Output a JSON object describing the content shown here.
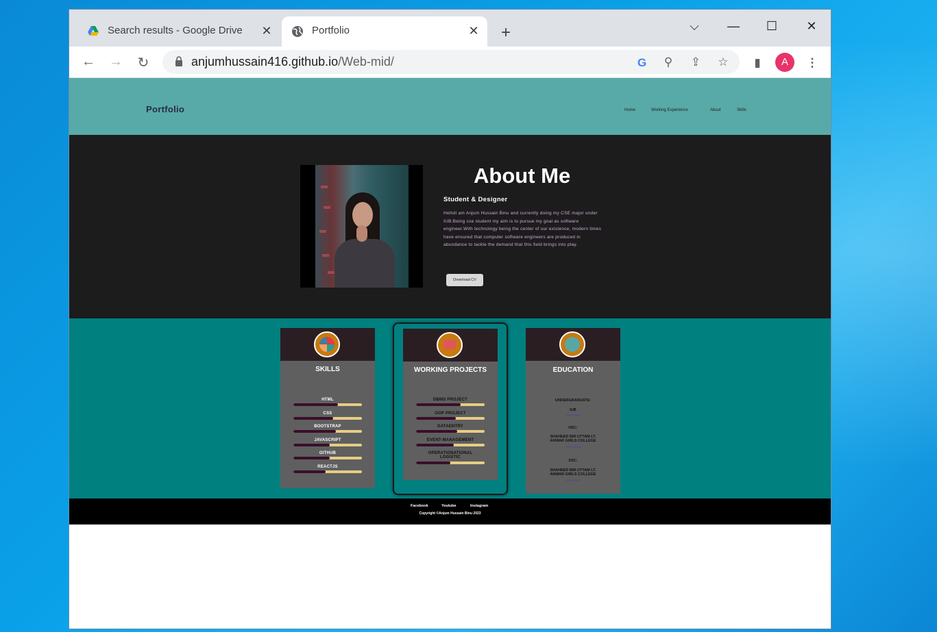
{
  "browser": {
    "tabs": [
      {
        "title": "Search results - Google Drive",
        "icon": "google-drive-icon",
        "active": false
      },
      {
        "title": "Portfolio",
        "icon": "globe-icon",
        "active": true
      }
    ],
    "new_tab_label": "+",
    "url_host": "anjumhussain416.github.io",
    "url_path": "/Web-mid/",
    "profile_initial": "A"
  },
  "site": {
    "logo": "Portfolio",
    "nav": [
      "Home",
      "Working Experience",
      "About",
      "Skills"
    ]
  },
  "about": {
    "title": "About Me",
    "subtitle": "Student & Designer",
    "text": "Helloll am Anjum Hussain Binu and currently doing my CSE major under IUB.Being cse student my aim is to pursue my goal as software engineer.With technology being the center of our existence, modern times have ensured that computer software engineers are produced in abundance to tackle the demand that this field brings into play.",
    "cv_button": "Download CV"
  },
  "skills": {
    "title": "SKILLS",
    "items": [
      {
        "label": "HTML",
        "level": 0.65
      },
      {
        "label": "CSS",
        "level": 0.58
      },
      {
        "label": "BOOTSTRAP",
        "level": 0.62
      },
      {
        "label": "JAVASCRIPT",
        "level": 0.53
      },
      {
        "label": "GITHUB",
        "level": 0.53
      },
      {
        "label": "REACTJS",
        "level": 0.47
      }
    ]
  },
  "projects": {
    "title": "WORKING PROJECTS",
    "items": [
      {
        "label": "DBMS PROJECT",
        "level": 0.65
      },
      {
        "label": "OOP PROJECT",
        "level": 0.58
      },
      {
        "label": "DATAENTRY",
        "level": 0.6
      },
      {
        "label": "EVENT-MANAGEMENT",
        "level": 0.55
      },
      {
        "label": "OPERATIONATIONAL LOGISTIC",
        "level": 0.5
      }
    ]
  },
  "education": {
    "title": "EDUCATION",
    "undergrad_label": "UNDERGRADUATE:",
    "undergrad_school": "IUB",
    "undergrad_years": "2020-2024",
    "hsc_label": "HSC:",
    "hsc_school": "SHAHEED BIR UTTAM LT. ANWAR GIRLS COLLEGE",
    "hsc_years": "2017-2019",
    "ssc_label": "SSC:",
    "ssc_school": "SHAHEED BIR UTTAM LT. ANWAR GIRLS COLLEGE",
    "ssc_years": "2005-2017"
  },
  "footer": {
    "links": [
      "Facebook",
      "Youtube",
      "Instagram"
    ],
    "copyright": "Copyright ©Anjum Hussain Binu 2023"
  }
}
